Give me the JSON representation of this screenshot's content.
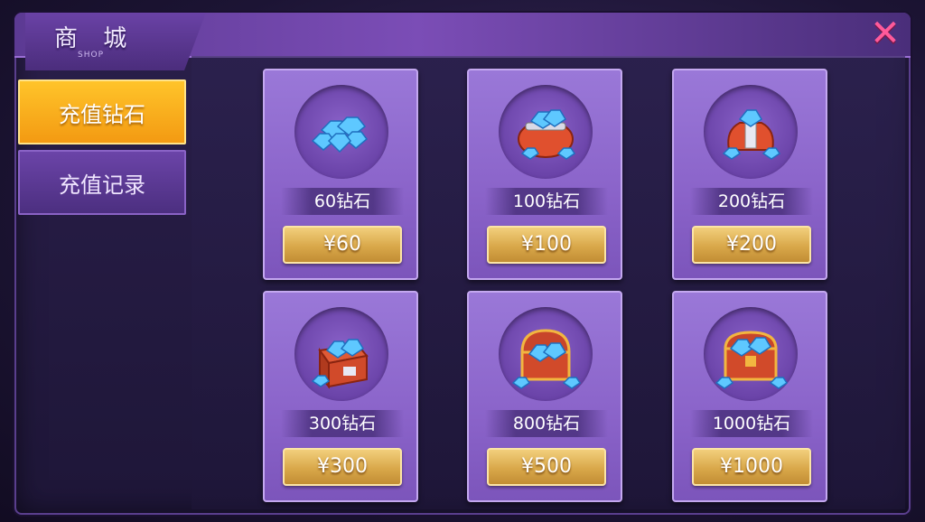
{
  "header": {
    "title": "商 城",
    "subtitle": "SHOP",
    "close_icon": "close-icon"
  },
  "sidebar": {
    "items": [
      {
        "label": "充值钻石",
        "active": true
      },
      {
        "label": "充值记录",
        "active": false
      }
    ]
  },
  "products": [
    {
      "name": "60钻石",
      "price": "¥60",
      "icon": "diamond-pile-icon"
    },
    {
      "name": "100钻石",
      "price": "¥100",
      "icon": "diamond-pouch-icon"
    },
    {
      "name": "200钻石",
      "price": "¥200",
      "icon": "diamond-sack-icon"
    },
    {
      "name": "300钻石",
      "price": "¥300",
      "icon": "diamond-box-icon"
    },
    {
      "name": "800钻石",
      "price": "¥500",
      "icon": "diamond-chest-icon"
    },
    {
      "name": "1000钻石",
      "price": "¥1000",
      "icon": "diamond-treasure-chest-icon"
    }
  ],
  "colors": {
    "accent_active": "#f39a12",
    "panel_purple": "#8a63c9",
    "price_gold": "#d9a84a",
    "close_pink": "#ff5a9a"
  }
}
